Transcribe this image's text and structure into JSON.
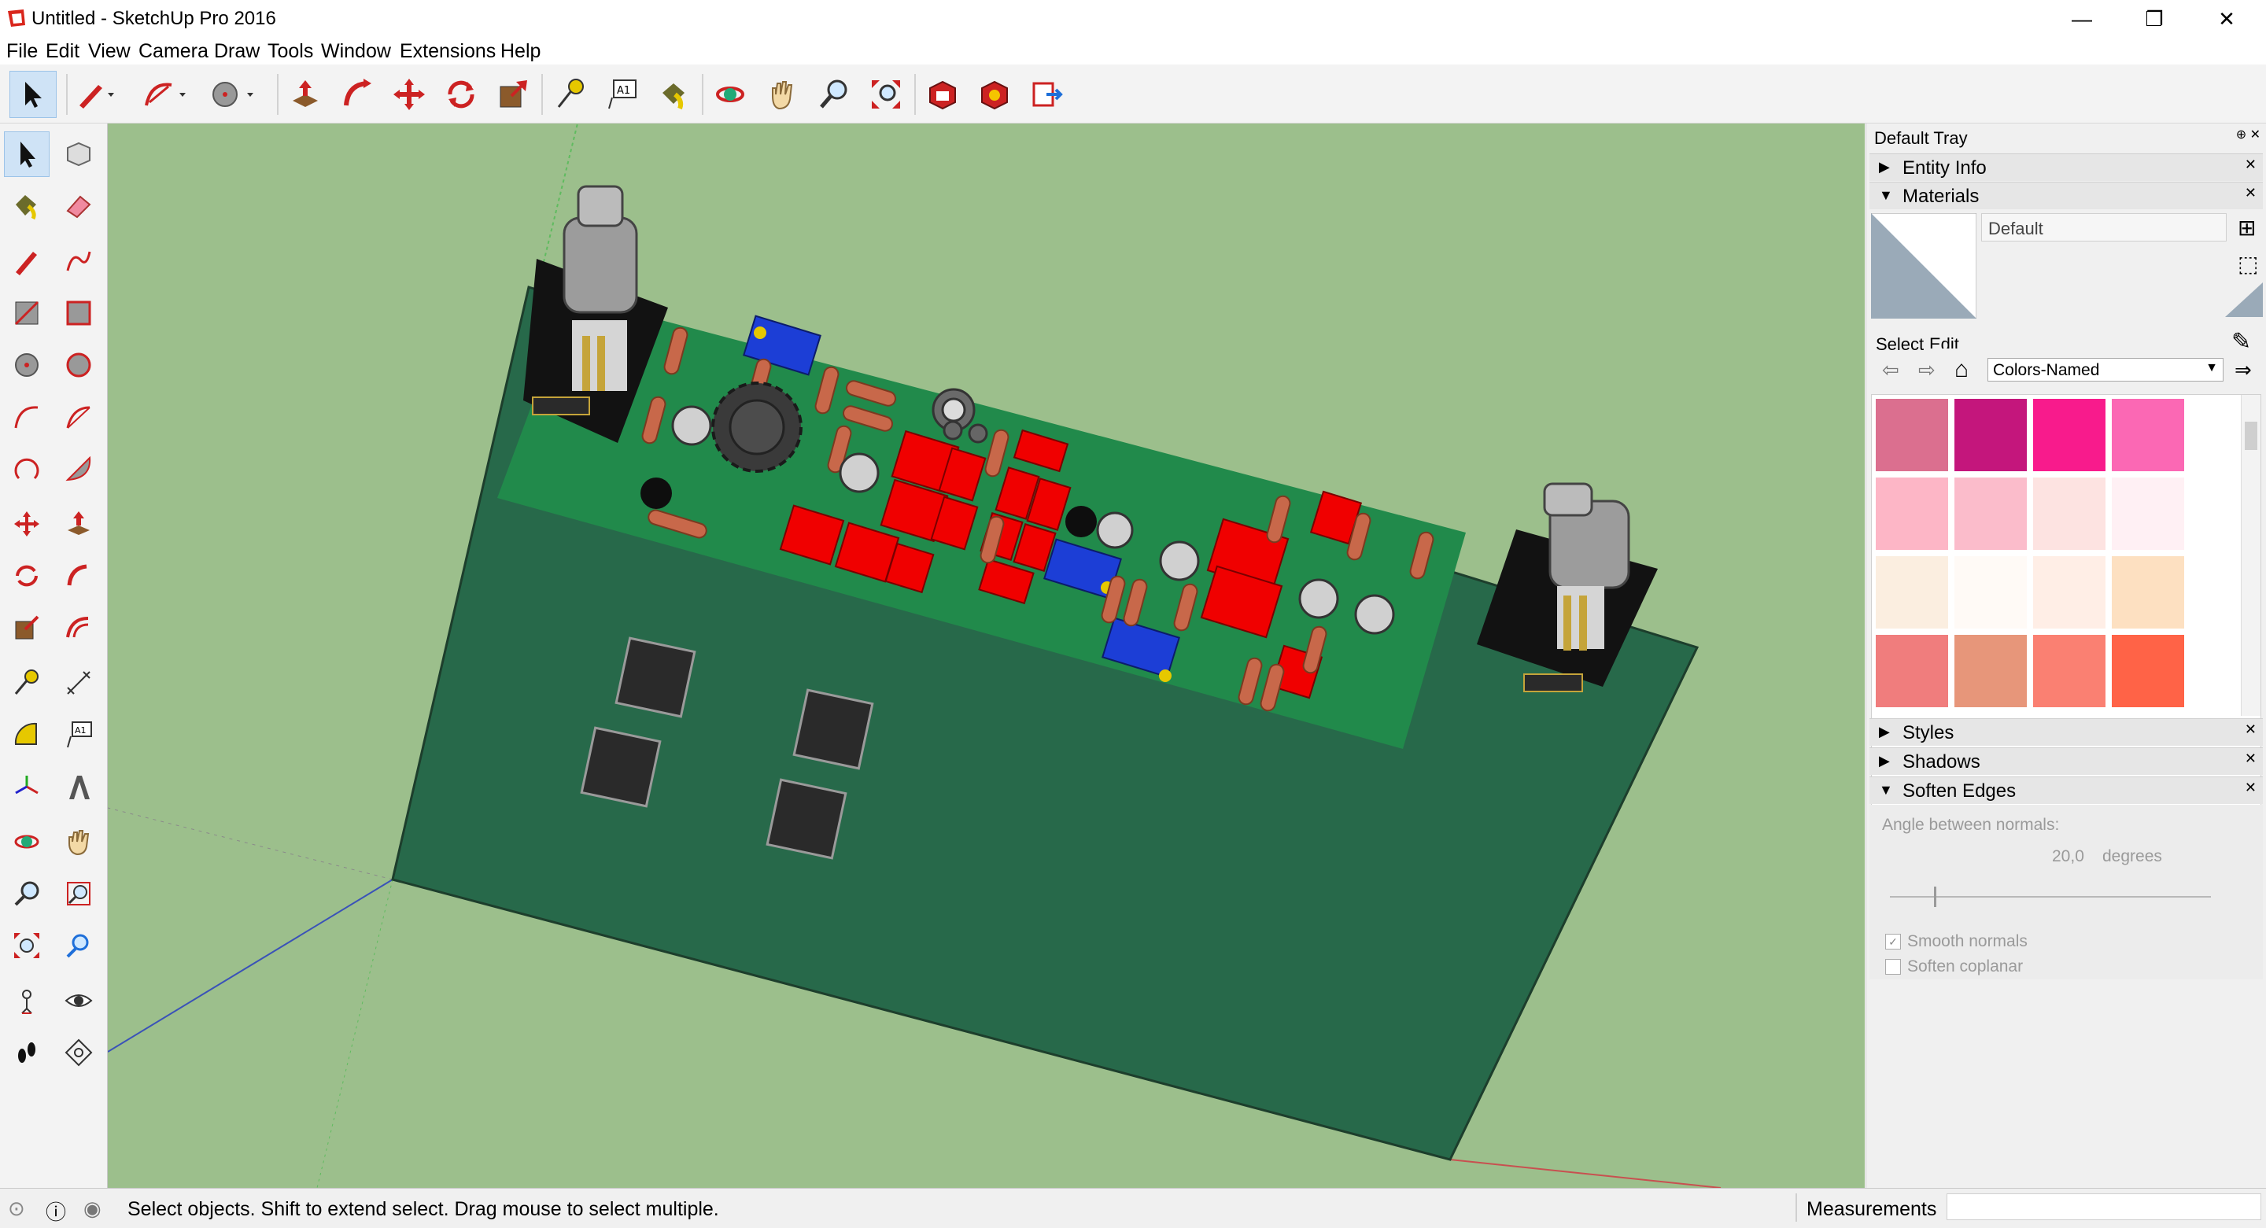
{
  "window": {
    "title": "Untitled - SketchUp Pro 2016",
    "minimize": "—",
    "restore": "❐",
    "close": "✕"
  },
  "menu": [
    "File",
    "Edit",
    "View",
    "Camera",
    "Draw",
    "Tools",
    "Window",
    "Extensions",
    "Help"
  ],
  "tray": {
    "title": "Default Tray",
    "sections": {
      "entity_info": "Entity Info",
      "materials": "Materials",
      "styles": "Styles",
      "shadows": "Shadows",
      "soften_edges": "Soften Edges"
    },
    "materials": {
      "name": "Default",
      "tab_select": "Select",
      "tab_edit": "Edit",
      "library": "Colors-Named",
      "swatches": [
        "#db6f8f",
        "#c4167c",
        "#f81b8c",
        "#fb68b4",
        "#fdb6c6",
        "#fbbccb",
        "#fde3e1",
        "#fff0f4",
        "#fbeee0",
        "#fffaf6",
        "#ffeee6",
        "#fde0c1",
        "#f07d7d",
        "#e7967a",
        "#fa8072",
        "#ff6347"
      ]
    },
    "soften": {
      "angle_label": "Angle between normals:",
      "angle_value": "20,0",
      "angle_unit": "degrees",
      "smooth_normals": "Smooth normals",
      "soften_coplanar": "Soften coplanar"
    }
  },
  "status": {
    "message": "Select objects. Shift to extend select. Drag mouse to select multiple.",
    "measurements_label": "Measurements"
  },
  "colors": {
    "sky_ground": "#9cbf8c",
    "board_dark": "#27694a",
    "board_light": "#218a4b"
  }
}
